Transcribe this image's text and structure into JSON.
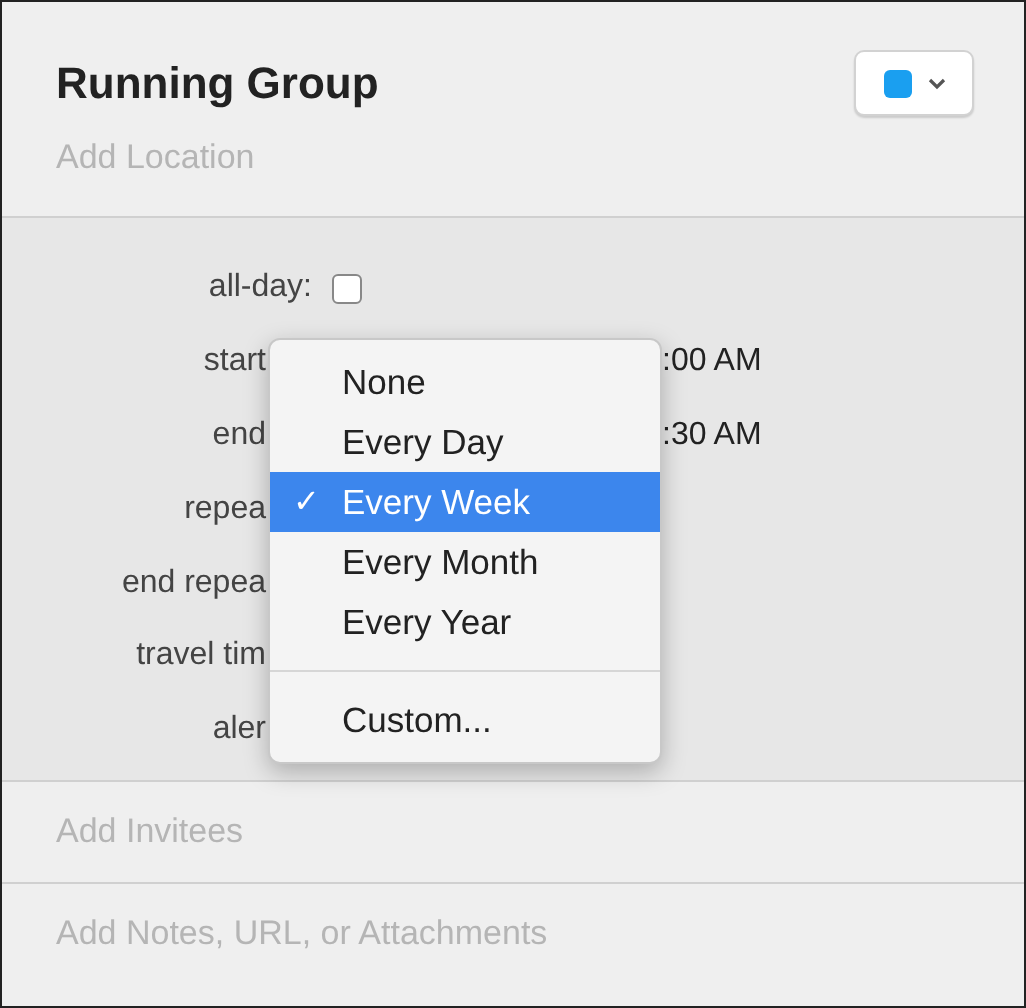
{
  "event": {
    "title": "Running Group",
    "location_placeholder": "Add Location",
    "color": "#1a9ff0"
  },
  "fields": [
    {
      "kind": "checkbox",
      "label": "all-day:",
      "checked": false
    },
    {
      "kind": "covered",
      "label": "start",
      "value": ":00 AM"
    },
    {
      "kind": "covered",
      "label": "end",
      "value": ":30 AM"
    },
    {
      "kind": "covered",
      "label": "repea"
    },
    {
      "kind": "covered",
      "label": "end repea"
    },
    {
      "kind": "covered",
      "label": "travel tim"
    },
    {
      "kind": "covered",
      "label": "aler"
    }
  ],
  "repeat_menu": [
    {
      "kind": "item",
      "label": "None",
      "selected": false
    },
    {
      "kind": "item",
      "label": "Every Day",
      "selected": false
    },
    {
      "kind": "item",
      "label": "Every Week",
      "selected": true
    },
    {
      "kind": "item",
      "label": "Every Month",
      "selected": false
    },
    {
      "kind": "item",
      "label": "Every Year",
      "selected": false
    },
    {
      "kind": "separator"
    },
    {
      "kind": "item",
      "label": "Custom...",
      "selected": false
    }
  ],
  "menu_check": "✓",
  "invitees_placeholder": "Add Invitees",
  "notes_placeholder": "Add Notes, URL, or Attachments"
}
